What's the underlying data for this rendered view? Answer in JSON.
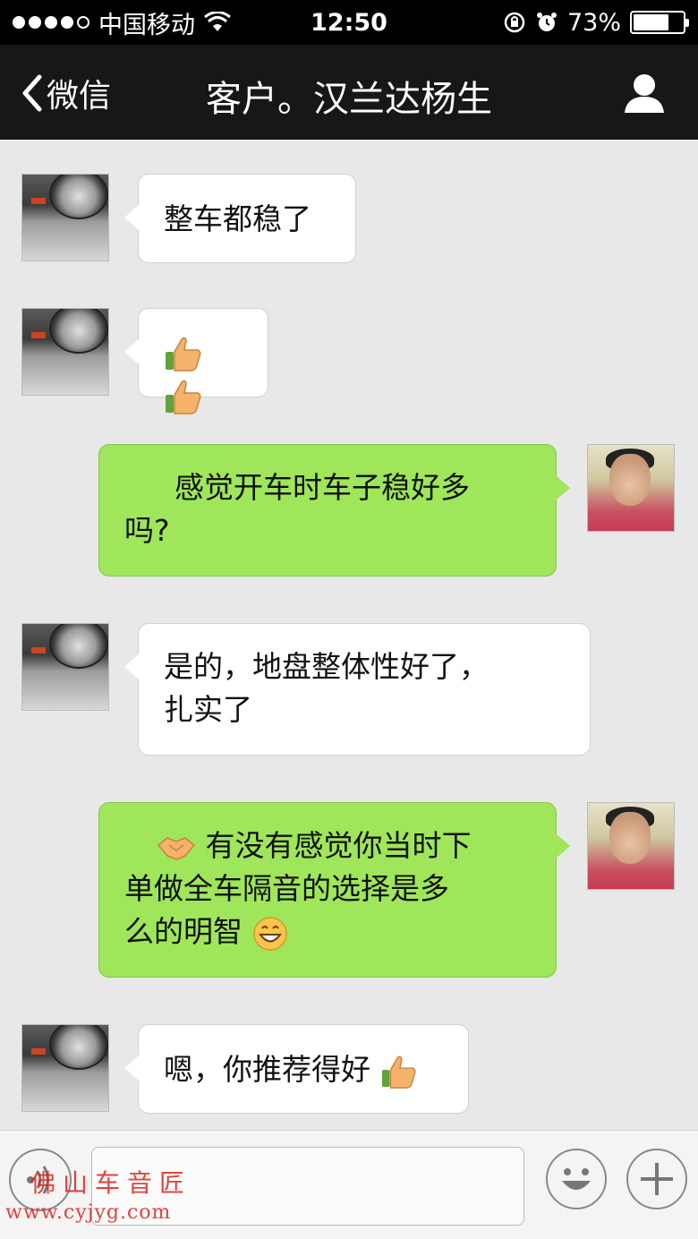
{
  "status_bar": {
    "carrier": "中国移动",
    "time": "12:50",
    "battery_percent": "73%",
    "battery_level": 0.73,
    "icons": [
      "signal-dots-icon",
      "wifi-icon",
      "rotation-lock-icon",
      "alarm-icon",
      "battery-icon"
    ]
  },
  "nav": {
    "back_label": "微信",
    "title": "客户。汉兰达杨生",
    "profile_icon": "person-icon"
  },
  "messages": [
    {
      "side": "in",
      "text": "整车都稳了",
      "emoji_after": []
    },
    {
      "side": "in",
      "text": "",
      "emoji_after": [
        "thumbs-up",
        "thumbs-up"
      ]
    },
    {
      "side": "out",
      "text_line1": "感觉开车时车子稳好多",
      "text_line2": "吗?"
    },
    {
      "side": "in",
      "text_line1": "是的，地盘整体性好了，",
      "text_line2": "扎实了"
    },
    {
      "side": "out",
      "text_line1": "有没有感觉你当时下",
      "text_line2": "单做全车隔音的选择是多",
      "text_line3": "么的明智",
      "emoji_before": "handshake",
      "emoji_after": "grinning"
    },
    {
      "side": "in",
      "text": "嗯，你推荐得好",
      "emoji_after": [
        "thumbs-up"
      ]
    }
  ],
  "input_bar": {
    "placeholder": "",
    "voice_icon": "voice-icon",
    "emoji_icon": "smiley-icon",
    "plus_icon": "plus-icon"
  },
  "watermark": {
    "text": "佛山车音匠",
    "url": "www.cyjyg.com"
  },
  "colors": {
    "status_bg": "#000000",
    "nav_bg": "#171717",
    "chat_bg": "#e8e8e8",
    "out_bubble": "#9fe65a",
    "in_bubble": "#ffffff",
    "watermark": "#dd2222"
  }
}
